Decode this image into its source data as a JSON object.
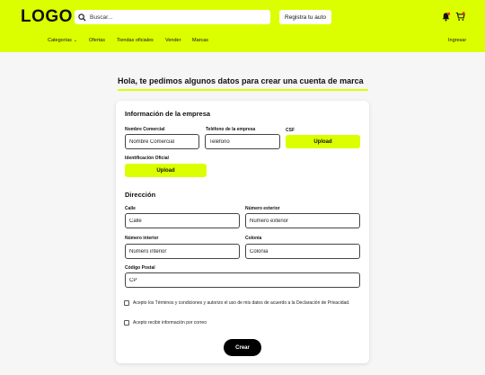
{
  "header": {
    "logo": "LOGO",
    "search_placeholder": "Buscar...",
    "register_label": "Registra tu auto",
    "nav": {
      "categories": "Categorías",
      "offers": "Ofertas",
      "stores": "Tiendas oficiales",
      "sell": "Vender",
      "brands": "Marcas",
      "login": "Ingresar"
    },
    "icons": [
      "bell-icon",
      "cart-icon",
      "search-icon",
      "chevron-down-icon"
    ]
  },
  "page": {
    "title": "Hola, te pedimos algunos datos para crear una cuenta de marca"
  },
  "form": {
    "company_section": "Información de la empresa",
    "commercial_name_label": "Nombre Comercial",
    "commercial_name_placeholder": "Nombre Comercial",
    "phone_label": "Teléfono de la empresa",
    "phone_placeholder": "Teléfono",
    "csf_label": "CSF",
    "csf_button": "Upload",
    "official_id_label": "Identificación Oficial",
    "official_id_button": "Upload",
    "address_section": "Dirección",
    "street_label": "Calle",
    "street_placeholder": "Calle",
    "ext_number_label": "Número exterior",
    "ext_number_placeholder": "Número exterior",
    "int_number_label": "Número interior",
    "int_number_placeholder": "Número interior",
    "colony_label": "Colonia",
    "colony_placeholder": "Colonia",
    "zip_label": "Código Postal",
    "zip_placeholder": "CP",
    "terms_text": "Acepto los Términos y condiciones y autorizo el uso de mis datos de acuerdo a la Declaración de Privacidad.",
    "mail_text": "Acepto recibir información por correo",
    "submit_label": "Crear"
  },
  "colors": {
    "accent": "#dcff00",
    "dark": "#000000",
    "background": "#f6f6f6"
  }
}
